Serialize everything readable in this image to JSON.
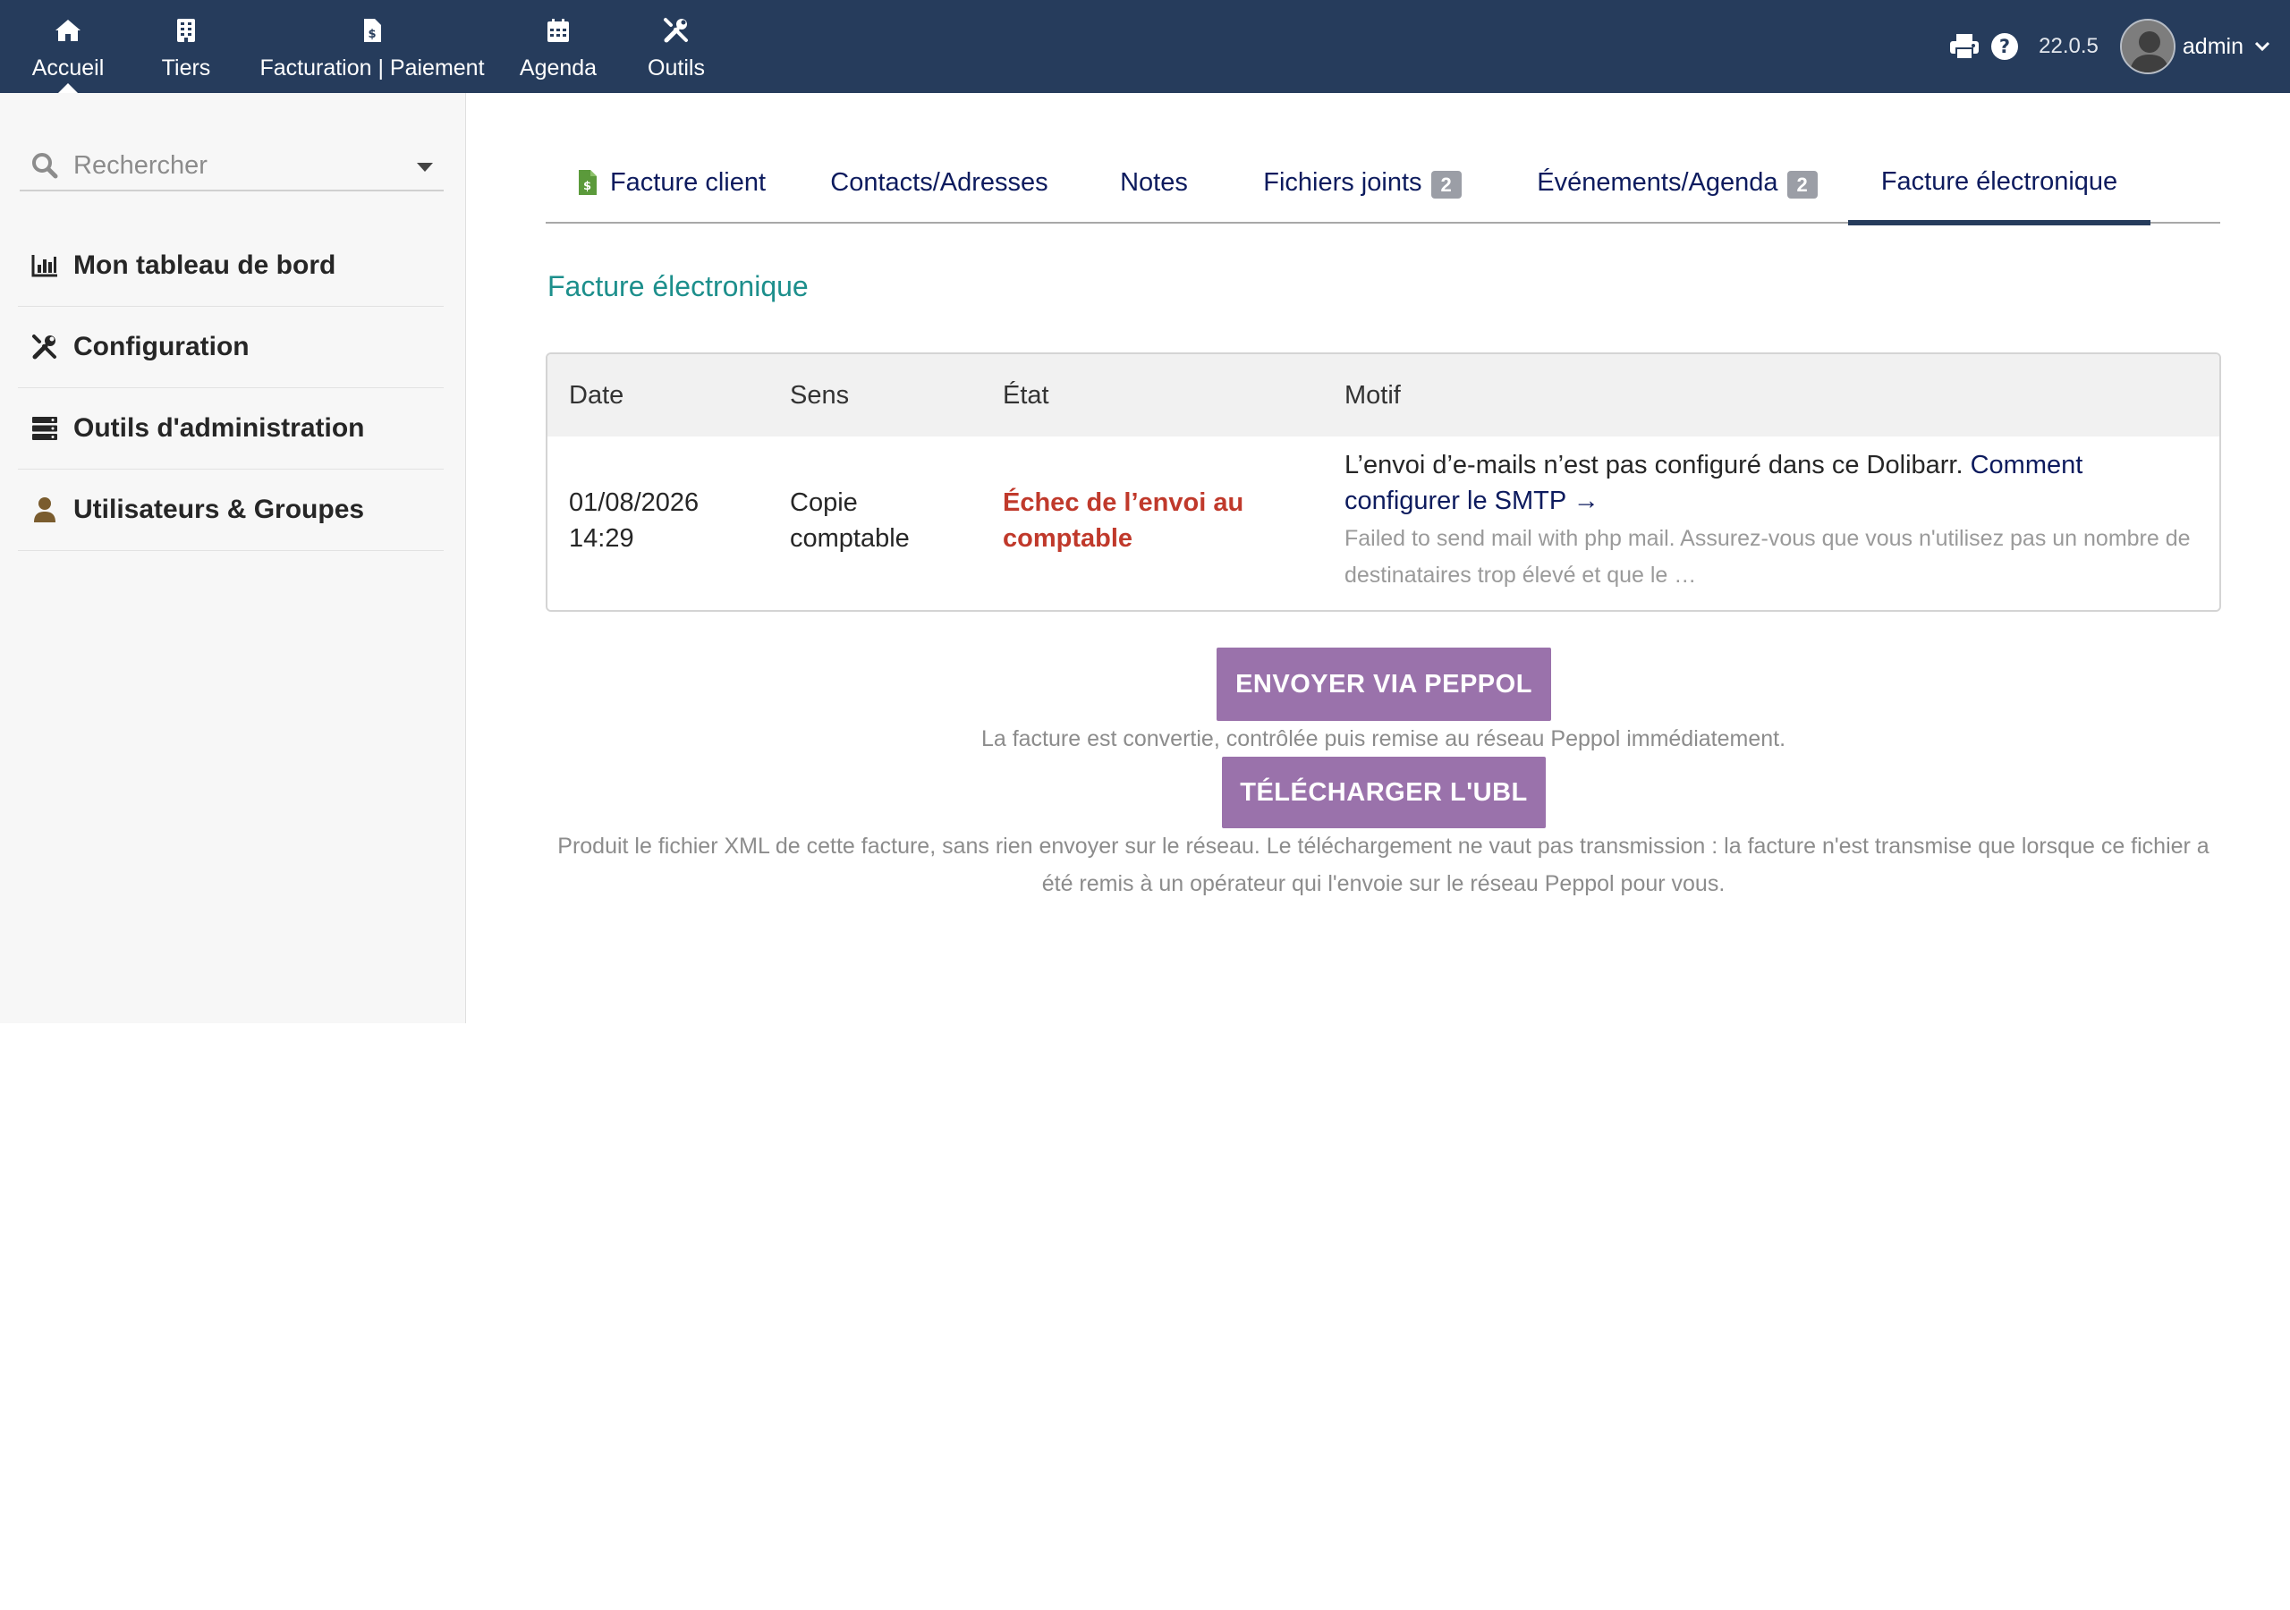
{
  "topnav": {
    "items": [
      {
        "label": "Accueil",
        "icon": "home-icon"
      },
      {
        "label": "Tiers",
        "icon": "building-icon"
      },
      {
        "label": "Facturation | Paiement",
        "icon": "invoice-icon"
      },
      {
        "label": "Agenda",
        "icon": "calendar-icon"
      },
      {
        "label": "Outils",
        "icon": "tools-icon"
      }
    ],
    "active_item": "Accueil",
    "version": "22.0.5",
    "username": "admin",
    "colors": {
      "bar": "#263c5c",
      "text": "#ffffff"
    }
  },
  "sidebar": {
    "search_placeholder": "Rechercher",
    "items": [
      {
        "label": "Mon tableau de bord",
        "icon": "chart-icon"
      },
      {
        "label": "Configuration",
        "icon": "tools-icon"
      },
      {
        "label": "Outils d'administration",
        "icon": "server-icon"
      },
      {
        "label": "Utilisateurs & Groupes",
        "icon": "user-icon"
      }
    ]
  },
  "tabs": {
    "items": [
      {
        "label": "Facture client",
        "icon": "invoice-file-icon"
      },
      {
        "label": "Contacts/Adresses"
      },
      {
        "label": "Notes"
      },
      {
        "label": "Fichiers joints",
        "badge": "2"
      },
      {
        "label": "Événements/Agenda",
        "badge": "2"
      },
      {
        "label": "Facture électronique"
      }
    ],
    "active": "Facture électronique"
  },
  "section": {
    "title": "Facture électronique",
    "title_color": "#1d8f8c"
  },
  "table": {
    "headers": {
      "date": "Date",
      "sens": "Sens",
      "etat": "État",
      "motif": "Motif"
    },
    "rows": [
      {
        "date_line1": "01/08/2026",
        "date_line2": "14:29",
        "sens_line1": "Copie",
        "sens_line2": "comptable",
        "etat_line1": "Échec de l’envoi au",
        "etat_line2": "comptable",
        "motif_text": "L’envoi d’e-mails n’est pas configuré dans ce Dolibarr. ",
        "motif_link": "Comment configurer le SMTP →",
        "motif_detail": "Failed to send mail with php mail. Assurez-vous que vous n'utilisez pas un nombre de destinataires trop élevé et que le …"
      }
    ],
    "state_color": "#c0392b"
  },
  "actions": {
    "peppol_button": "ENVOYER VIA PEPPOL",
    "peppol_hint": "La facture est convertie, contrôlée puis remise au réseau Peppol immédiatement.",
    "ubl_button": "TÉLÉCHARGER L'UBL",
    "ubl_hint": "Produit le fichier XML de cette facture, sans rien envoyer sur le réseau. Le téléchargement ne vaut pas transmission : la facture n'est transmise que lorsque ce fichier a été remis à un opérateur qui l'envoie sur le réseau Peppol pour vous.",
    "button_color": "#9a72ab"
  }
}
